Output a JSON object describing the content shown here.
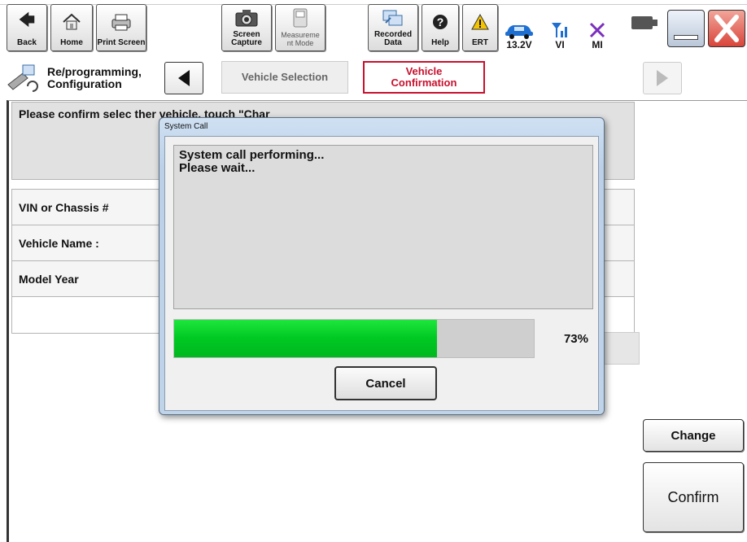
{
  "toolbar": {
    "back": "Back",
    "home": "Home",
    "print_screen": "Print Screen",
    "screen_capture": "Screen Capture",
    "measurement_mode": "Measureme nt Mode",
    "recorded_data": "Recorded Data",
    "help": "Help",
    "ert": "ERT",
    "voltage": "13.2V",
    "vi": "VI",
    "mi": "MI"
  },
  "breadcrumb": {
    "reprogramming": "Re/programming, Configuration",
    "vehicle_selection": "Vehicle Selection",
    "vehicle_confirmation": "Vehicle Confirmation"
  },
  "main": {
    "instruction": "Please confirm selec                                                   ther vehicle, touch \"Char",
    "rows": [
      {
        "label": "VIN or Chassis #"
      },
      {
        "label": "Vehicle Name :"
      },
      {
        "label": "Model Year"
      },
      {
        "label": ""
      }
    ],
    "change_label": "Change",
    "confirm_label": "Confirm"
  },
  "dialog": {
    "title": "System Call",
    "message_line1": "System call performing...",
    "message_line2": "Please wait...",
    "progress_text": "73%",
    "progress_fraction": 0.73,
    "cancel_label": "Cancel"
  },
  "colors": {
    "active_crumb": "#c8102e",
    "progress_green": "#00c823"
  }
}
